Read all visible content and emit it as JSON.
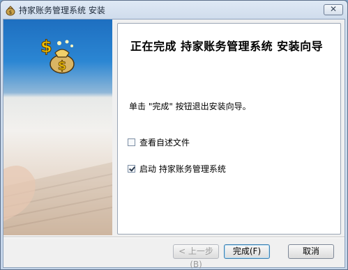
{
  "window": {
    "title": "持家账务管理系统 安装",
    "close_label": "✕"
  },
  "content": {
    "heading": "正在完成 持家账务管理系统 安装向导",
    "description": "单击 \"完成\" 按钮退出安装向导。",
    "options": [
      {
        "label": "查看自述文件",
        "checked": false
      },
      {
        "label": "启动 持家账务管理系统",
        "checked": true
      }
    ]
  },
  "buttons": {
    "back": "< 上一步(B)",
    "finish": "完成(F)",
    "cancel": "取消"
  },
  "colors": {
    "banner_blue": "#2b86d3",
    "logo_gold": "#f2c200"
  }
}
